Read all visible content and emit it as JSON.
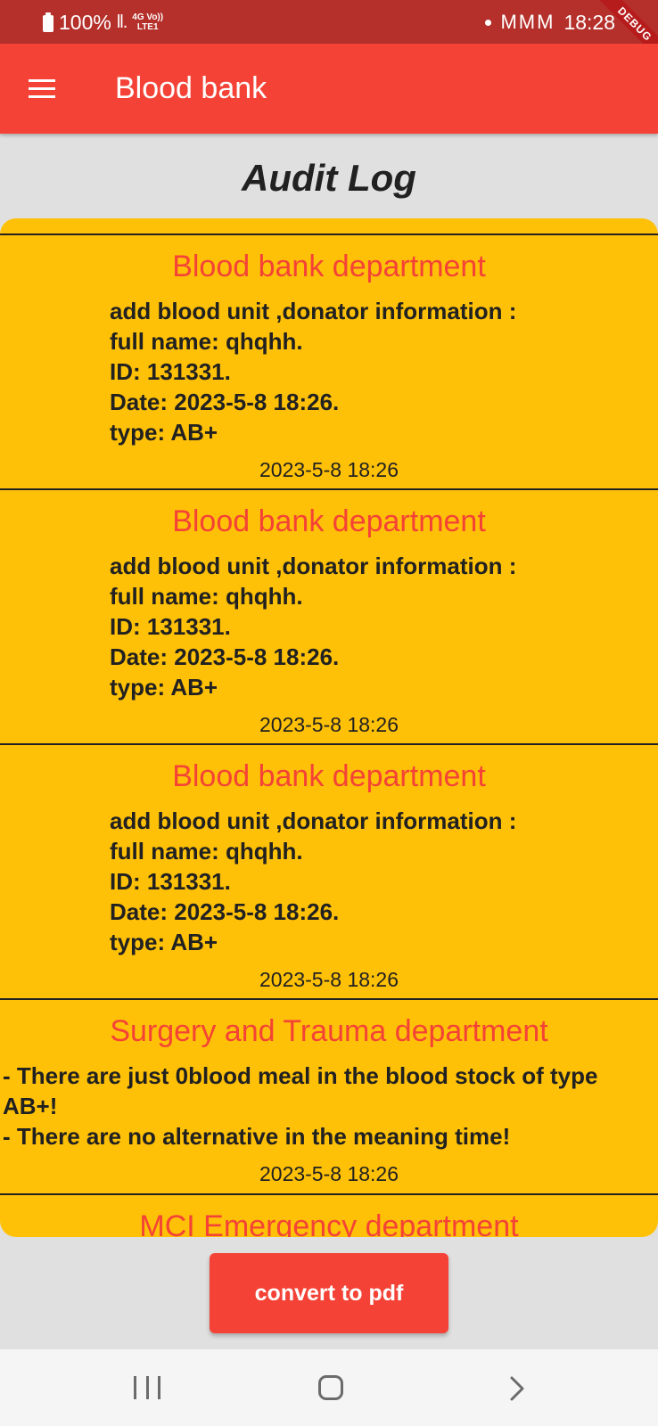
{
  "status_bar": {
    "battery": "100%",
    "signal": "ll.",
    "network_top": "4G Vo))",
    "network_bottom": "LTE1",
    "notifications": "MMM",
    "time": "18:28",
    "debug_banner": "DEBUG"
  },
  "app_bar": {
    "title": "Blood bank"
  },
  "page": {
    "title": "Audit Log"
  },
  "logs": [
    {
      "department": "Blood bank department",
      "message": "add blood unit ,donator information :\nfull name: qhqhh.\nID: 131331.\nDate: 2023-5-8 18:26.\ntype: AB+",
      "timestamp": "2023-5-8 18:26"
    },
    {
      "department": "Blood bank department",
      "message": "add blood unit ,donator information :\nfull name: qhqhh.\nID: 131331.\nDate: 2023-5-8 18:26.\ntype: AB+",
      "timestamp": "2023-5-8 18:26"
    },
    {
      "department": "Blood bank department",
      "message": "add blood unit ,donator information :\nfull name: qhqhh.\nID: 131331.\nDate: 2023-5-8 18:26.\ntype: AB+",
      "timestamp": "2023-5-8 18:26"
    },
    {
      "department": "Surgery and Trauma department",
      "message": "- There are just 0blood meal in the blood stock of type AB+!\n - There are no alternative in the meaning time!",
      "timestamp": "2023-5-8 18:26"
    },
    {
      "department": "MCI Emergency department",
      "message": "",
      "timestamp": ""
    }
  ],
  "actions": {
    "convert_label": "convert to pdf"
  },
  "colors": {
    "status_bar": "#b5302b",
    "app_bar": "#f44336",
    "panel": "#ffc107",
    "department_text": "#f44336",
    "background": "#e0e0e0"
  },
  "icons": {
    "menu": "menu-icon",
    "recent_apps": "recent-apps-icon",
    "home": "home-icon",
    "back": "back-icon"
  }
}
